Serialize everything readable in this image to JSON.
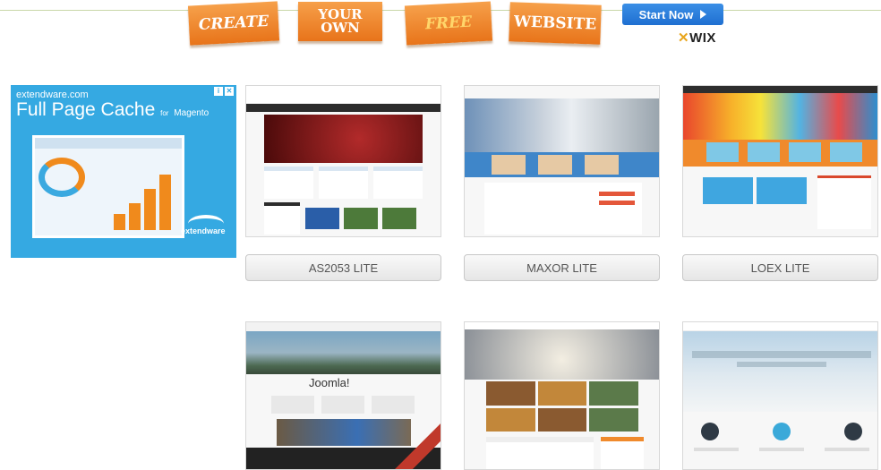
{
  "banner": {
    "words": [
      "CREATE",
      "YOUR",
      "OWN",
      "FREE",
      "WEBSITE"
    ],
    "start_label": "Start Now",
    "brand": "WIX"
  },
  "ad": {
    "domain": "extendware.com",
    "headline": "Full Page Cache",
    "for_text": "for",
    "platform": "Magento",
    "logo": "extendware"
  },
  "templates": [
    {
      "name": "AS2053 LITE"
    },
    {
      "name": "MAXOR LITE"
    },
    {
      "name": "LOEX LITE"
    },
    {
      "name": "",
      "logo_text": "Joomla!"
    },
    {
      "name": ""
    },
    {
      "name": ""
    }
  ],
  "colors": {
    "tag_orange": "#e8741a",
    "start_blue": "#1f6fd1",
    "ad_blue": "#35a9e2",
    "accent_orange": "#f08a1c"
  }
}
